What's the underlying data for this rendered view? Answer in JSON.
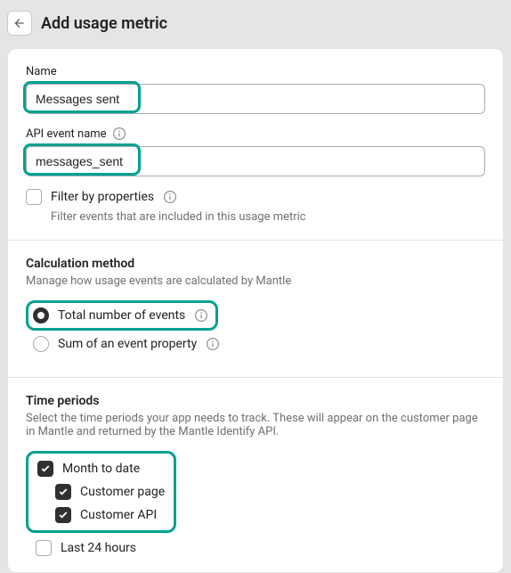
{
  "header": {
    "title": "Add usage metric"
  },
  "form": {
    "name_label": "Name",
    "name_value": "Messages sent",
    "api_label": "API event name",
    "api_value": "messages_sent",
    "filter_label": "Filter by properties",
    "filter_help": "Filter events that are included in this usage metric"
  },
  "calc": {
    "heading": "Calculation method",
    "desc": "Manage how usage events are calculated by Mantle",
    "total_label": "Total number of events",
    "sum_label": "Sum of an event property"
  },
  "time": {
    "heading": "Time periods",
    "desc": "Select the time periods your app needs to track. These will appear on the customer page in Mantle and returned by the Mantle Identify API.",
    "mtd_label": "Month to date",
    "cust_page_label": "Customer page",
    "cust_api_label": "Customer API",
    "last24_label": "Last 24 hours"
  }
}
